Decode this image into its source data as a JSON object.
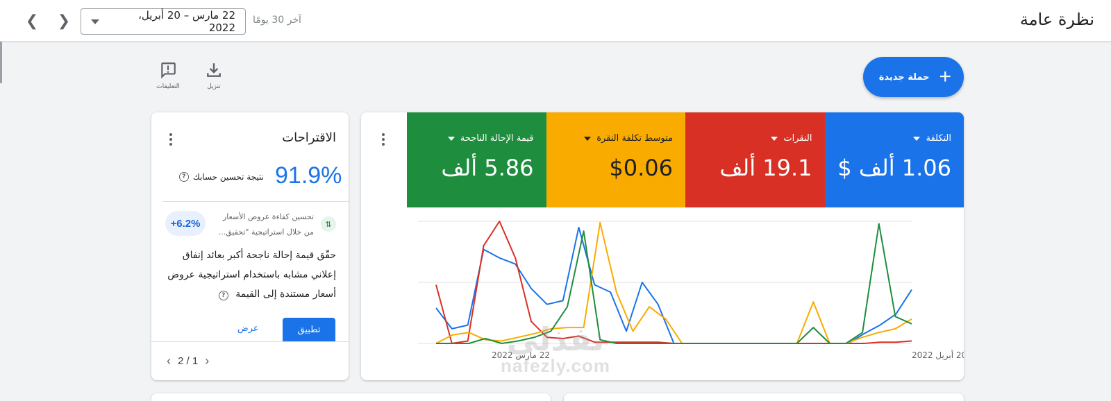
{
  "header": {
    "title": "نظرة عامة",
    "date_range": "22 مارس – 20 أبريل، 2022",
    "range_label": "آخر 30 يومًا"
  },
  "toolbar": {
    "download_label": "تنزيل",
    "feedback_label": "التعليقات"
  },
  "new_campaign": {
    "label": "حملة جديدة",
    "plus": "+"
  },
  "metrics": [
    {
      "label": "التكلفة",
      "value": "1.06 ألف $",
      "color": "#1a73e8"
    },
    {
      "label": "النقرات",
      "value": "19.1 ألف",
      "color": "#d93025"
    },
    {
      "label": "متوسط تكلفة النقرة",
      "value": "$0.06",
      "color": "#f9ab00"
    },
    {
      "label": "قيمة الإحالة الناجحة",
      "value": "5.86 ألف",
      "color": "#1e8e3e"
    }
  ],
  "chart_data": {
    "type": "line",
    "x_start_label": "22 مارس 2022",
    "x_end_label": "20 أبريل 2022",
    "ylim": [
      0,
      100
    ],
    "grid": true,
    "series": [
      {
        "color": "#1a73e8",
        "values": [
          29,
          12,
          15,
          77,
          70,
          65,
          45,
          32,
          35,
          95,
          48,
          42,
          10,
          50,
          32,
          0,
          0,
          0,
          0,
          0,
          0,
          0,
          0,
          0,
          0,
          0,
          0,
          8,
          15,
          24,
          44
        ]
      },
      {
        "color": "#d93025",
        "values": [
          48,
          0,
          2,
          80,
          100,
          70,
          18,
          5,
          4,
          6,
          1,
          1,
          1,
          1,
          1,
          0,
          0,
          0,
          0,
          0,
          0,
          0,
          0,
          0,
          0,
          0,
          0,
          0,
          1,
          1,
          2
        ]
      },
      {
        "color": "#f9ab00",
        "values": [
          0,
          7,
          9,
          3,
          2,
          5,
          8,
          12,
          13,
          13,
          99,
          42,
          10,
          30,
          20,
          0,
          0,
          0,
          0,
          0,
          0,
          0,
          0,
          34,
          0,
          0,
          5,
          9,
          12,
          20
        ]
      },
      {
        "color": "#1e8e3e",
        "values": [
          0,
          0,
          0,
          4,
          0,
          2,
          5,
          10,
          30,
          92,
          3,
          0,
          0,
          0,
          0,
          0,
          0,
          0,
          0,
          0,
          0,
          0,
          0,
          13,
          0,
          0,
          9,
          98,
          22,
          16
        ]
      }
    ]
  },
  "suggestions": {
    "title": "الاقتراحات",
    "score": "91.9%",
    "score_label": "نتيجة تحسين حسابك",
    "help_glyph": "?",
    "item": {
      "uplift": "+6.2%",
      "subtitle_line1": "تحسين كفاءة عروض الأسعار",
      "subtitle_line2": "من خلال استراتيجية \"تحقيق...",
      "body": "حقّق قيمة إحالة ناجحة أكبر بعائد إنفاق إعلاني مشابه باستخدام استراتيجية عروض أسعار مستندة إلى القيمة",
      "apply_label": "تطبيق",
      "view_label": "عرض"
    },
    "pager": "2 / 1"
  },
  "watermark": {
    "arabic": "نفذلي",
    "latin": "nafezly.com"
  }
}
